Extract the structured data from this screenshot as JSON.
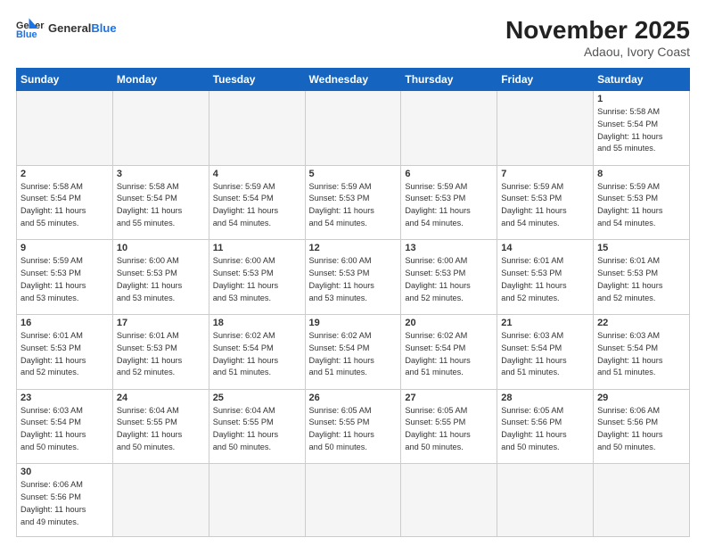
{
  "header": {
    "logo_general": "General",
    "logo_blue": "Blue",
    "month_title": "November 2025",
    "location": "Adaou, Ivory Coast"
  },
  "weekdays": [
    "Sunday",
    "Monday",
    "Tuesday",
    "Wednesday",
    "Thursday",
    "Friday",
    "Saturday"
  ],
  "weeks": [
    [
      {
        "day": "",
        "empty": true
      },
      {
        "day": "",
        "empty": true
      },
      {
        "day": "",
        "empty": true
      },
      {
        "day": "",
        "empty": true
      },
      {
        "day": "",
        "empty": true
      },
      {
        "day": "",
        "empty": true
      },
      {
        "day": "1",
        "info": "Sunrise: 5:58 AM\nSunset: 5:54 PM\nDaylight: 11 hours\nand 55 minutes."
      }
    ],
    [
      {
        "day": "2",
        "info": "Sunrise: 5:58 AM\nSunset: 5:54 PM\nDaylight: 11 hours\nand 55 minutes."
      },
      {
        "day": "3",
        "info": "Sunrise: 5:58 AM\nSunset: 5:54 PM\nDaylight: 11 hours\nand 55 minutes."
      },
      {
        "day": "4",
        "info": "Sunrise: 5:59 AM\nSunset: 5:54 PM\nDaylight: 11 hours\nand 54 minutes."
      },
      {
        "day": "5",
        "info": "Sunrise: 5:59 AM\nSunset: 5:53 PM\nDaylight: 11 hours\nand 54 minutes."
      },
      {
        "day": "6",
        "info": "Sunrise: 5:59 AM\nSunset: 5:53 PM\nDaylight: 11 hours\nand 54 minutes."
      },
      {
        "day": "7",
        "info": "Sunrise: 5:59 AM\nSunset: 5:53 PM\nDaylight: 11 hours\nand 54 minutes."
      },
      {
        "day": "8",
        "info": "Sunrise: 5:59 AM\nSunset: 5:53 PM\nDaylight: 11 hours\nand 54 minutes."
      }
    ],
    [
      {
        "day": "9",
        "info": "Sunrise: 5:59 AM\nSunset: 5:53 PM\nDaylight: 11 hours\nand 53 minutes."
      },
      {
        "day": "10",
        "info": "Sunrise: 6:00 AM\nSunset: 5:53 PM\nDaylight: 11 hours\nand 53 minutes."
      },
      {
        "day": "11",
        "info": "Sunrise: 6:00 AM\nSunset: 5:53 PM\nDaylight: 11 hours\nand 53 minutes."
      },
      {
        "day": "12",
        "info": "Sunrise: 6:00 AM\nSunset: 5:53 PM\nDaylight: 11 hours\nand 53 minutes."
      },
      {
        "day": "13",
        "info": "Sunrise: 6:00 AM\nSunset: 5:53 PM\nDaylight: 11 hours\nand 52 minutes."
      },
      {
        "day": "14",
        "info": "Sunrise: 6:01 AM\nSunset: 5:53 PM\nDaylight: 11 hours\nand 52 minutes."
      },
      {
        "day": "15",
        "info": "Sunrise: 6:01 AM\nSunset: 5:53 PM\nDaylight: 11 hours\nand 52 minutes."
      }
    ],
    [
      {
        "day": "16",
        "info": "Sunrise: 6:01 AM\nSunset: 5:53 PM\nDaylight: 11 hours\nand 52 minutes."
      },
      {
        "day": "17",
        "info": "Sunrise: 6:01 AM\nSunset: 5:53 PM\nDaylight: 11 hours\nand 52 minutes."
      },
      {
        "day": "18",
        "info": "Sunrise: 6:02 AM\nSunset: 5:54 PM\nDaylight: 11 hours\nand 51 minutes."
      },
      {
        "day": "19",
        "info": "Sunrise: 6:02 AM\nSunset: 5:54 PM\nDaylight: 11 hours\nand 51 minutes."
      },
      {
        "day": "20",
        "info": "Sunrise: 6:02 AM\nSunset: 5:54 PM\nDaylight: 11 hours\nand 51 minutes."
      },
      {
        "day": "21",
        "info": "Sunrise: 6:03 AM\nSunset: 5:54 PM\nDaylight: 11 hours\nand 51 minutes."
      },
      {
        "day": "22",
        "info": "Sunrise: 6:03 AM\nSunset: 5:54 PM\nDaylight: 11 hours\nand 51 minutes."
      }
    ],
    [
      {
        "day": "23",
        "info": "Sunrise: 6:03 AM\nSunset: 5:54 PM\nDaylight: 11 hours\nand 50 minutes."
      },
      {
        "day": "24",
        "info": "Sunrise: 6:04 AM\nSunset: 5:55 PM\nDaylight: 11 hours\nand 50 minutes."
      },
      {
        "day": "25",
        "info": "Sunrise: 6:04 AM\nSunset: 5:55 PM\nDaylight: 11 hours\nand 50 minutes."
      },
      {
        "day": "26",
        "info": "Sunrise: 6:05 AM\nSunset: 5:55 PM\nDaylight: 11 hours\nand 50 minutes."
      },
      {
        "day": "27",
        "info": "Sunrise: 6:05 AM\nSunset: 5:55 PM\nDaylight: 11 hours\nand 50 minutes."
      },
      {
        "day": "28",
        "info": "Sunrise: 6:05 AM\nSunset: 5:56 PM\nDaylight: 11 hours\nand 50 minutes."
      },
      {
        "day": "29",
        "info": "Sunrise: 6:06 AM\nSunset: 5:56 PM\nDaylight: 11 hours\nand 50 minutes."
      }
    ],
    [
      {
        "day": "30",
        "info": "Sunrise: 6:06 AM\nSunset: 5:56 PM\nDaylight: 11 hours\nand 49 minutes.",
        "last": true
      },
      {
        "day": "",
        "empty": true,
        "last": true
      },
      {
        "day": "",
        "empty": true,
        "last": true
      },
      {
        "day": "",
        "empty": true,
        "last": true
      },
      {
        "day": "",
        "empty": true,
        "last": true
      },
      {
        "day": "",
        "empty": true,
        "last": true
      },
      {
        "day": "",
        "empty": true,
        "last": true
      }
    ]
  ]
}
